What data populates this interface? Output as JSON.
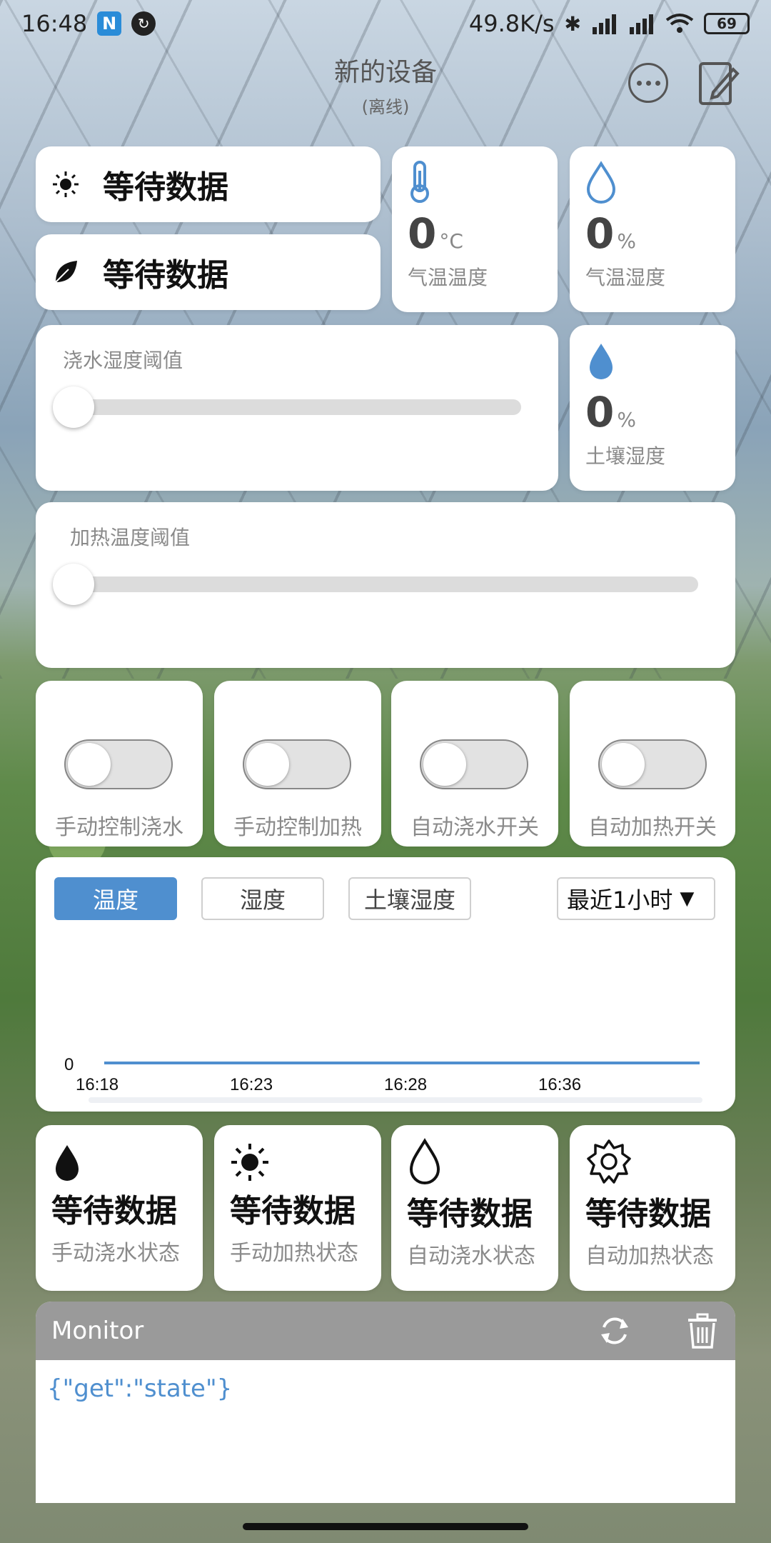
{
  "status_bar": {
    "time": "16:48",
    "badge": "N",
    "net_speed": "49.8K/s",
    "battery": "69"
  },
  "header": {
    "title": "新的设备",
    "subtitle": "(离线)"
  },
  "info_cards": {
    "light": {
      "label": "等待数据",
      "icon": "sun-icon"
    },
    "plant": {
      "label": "等待数据",
      "icon": "leaf-icon"
    }
  },
  "sensors": {
    "air_temp": {
      "value": "0",
      "unit": "°C",
      "label": "气温温度",
      "icon": "thermometer-icon"
    },
    "air_humidity": {
      "value": "0",
      "unit": "%",
      "label": "气温湿度",
      "icon": "droplet-outline-icon"
    },
    "soil_humidity": {
      "value": "0",
      "unit": "%",
      "label": "土壤湿度",
      "icon": "droplet-filled-icon"
    }
  },
  "sliders": {
    "watering_threshold": {
      "label": "浇水湿度阈值",
      "value": 0
    },
    "heating_threshold": {
      "label": "加热温度阈值",
      "value": 0
    }
  },
  "toggles": [
    {
      "label": "手动控制浇水",
      "on": false
    },
    {
      "label": "手动控制加热",
      "on": false
    },
    {
      "label": "自动浇水开关",
      "on": false
    },
    {
      "label": "自动加热开关",
      "on": false
    }
  ],
  "chart": {
    "tabs": [
      "温度",
      "湿度",
      "土壤湿度"
    ],
    "active_tab": 0,
    "range": "最近1小时",
    "accent": "#4f8fcf"
  },
  "chart_data": {
    "type": "line",
    "x": [
      "16:18",
      "16:23",
      "16:28",
      "16:36"
    ],
    "series": [
      {
        "values": [
          0,
          0,
          0,
          0
        ]
      }
    ],
    "y_tick_labels": [
      "0"
    ],
    "ylim": [
      0,
      0
    ]
  },
  "status_cards": [
    {
      "value": "等待数据",
      "label": "手动浇水状态",
      "icon": "droplet-filled-icon"
    },
    {
      "value": "等待数据",
      "label": "手动加热状态",
      "icon": "sun-icon"
    },
    {
      "value": "等待数据",
      "label": "自动浇水状态",
      "icon": "droplet-outline-icon"
    },
    {
      "value": "等待数据",
      "label": "自动加热状态",
      "icon": "gear-icon"
    }
  ],
  "monitor": {
    "title": "Monitor",
    "log": "{\"get\":\"state\"}"
  }
}
